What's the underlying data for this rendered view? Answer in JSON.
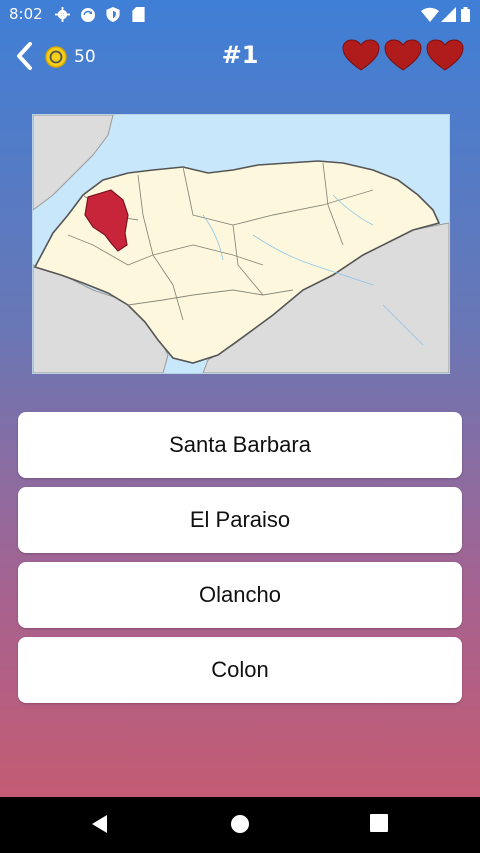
{
  "status_bar": {
    "time": "8:02",
    "icons": [
      "gear-icon",
      "sync-icon",
      "shield-icon",
      "sd-card-icon",
      "wifi-icon",
      "signal-icon",
      "battery-icon"
    ]
  },
  "header": {
    "coins": "50",
    "level": "#1",
    "lives": 3
  },
  "map": {
    "highlight_color": "#c8253a"
  },
  "answers": [
    {
      "label": "Santa Barbara"
    },
    {
      "label": "El Paraiso"
    },
    {
      "label": "Olancho"
    },
    {
      "label": "Colon"
    }
  ],
  "nav": {
    "icons": [
      "back-triangle-icon",
      "home-circle-icon",
      "recents-square-icon"
    ]
  }
}
